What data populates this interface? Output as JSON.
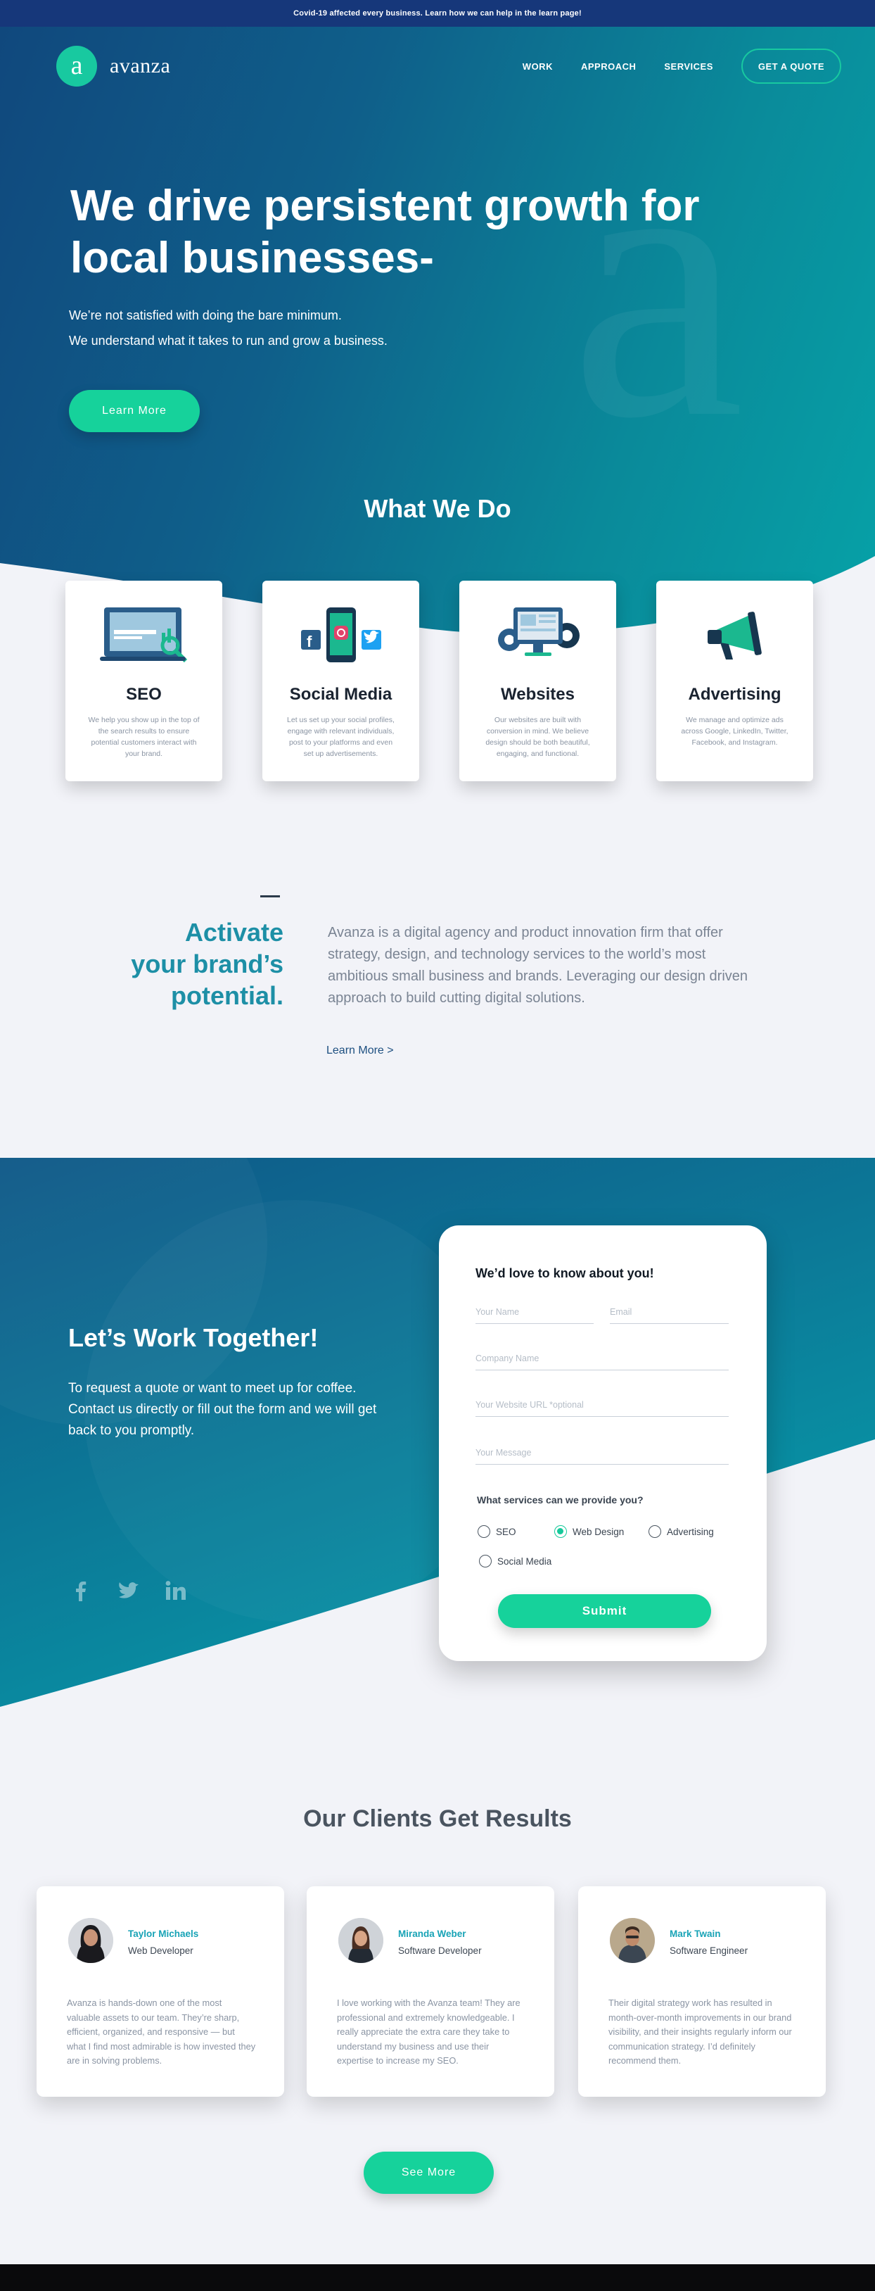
{
  "announcement": "Covid-19 affected every business. Learn how we can help in the learn page!",
  "brand": {
    "mark": "a",
    "name": "avanza"
  },
  "nav": {
    "items": [
      "WORK",
      "APPROACH",
      "SERVICES"
    ],
    "cta": "GET A QUOTE"
  },
  "hero": {
    "title_line1": "We drive persistent growth for",
    "title_line2": "local businesses-",
    "sub_line1": "We’re not satisfied with doing the bare minimum.",
    "sub_line2": "We understand what it takes to run and grow a business.",
    "button": "Learn More"
  },
  "services": {
    "heading": "What We Do",
    "cards": [
      {
        "icon": "seo-laptop-icon",
        "title": "SEO",
        "text": "We help you show up in the top of the search results to ensure potential customers interact with your brand."
      },
      {
        "icon": "social-phone-icon",
        "title": "Social Media",
        "text": "Let us set up your social profiles, engage with relevant individuals, post to your platforms and even set up advertisements."
      },
      {
        "icon": "website-monitor-icon",
        "title": "Websites",
        "text": "Our websites are built with conversion in mind. We believe design should be both beautiful, engaging, and functional."
      },
      {
        "icon": "megaphone-icon",
        "title": "Advertising",
        "text": "We manage and optimize ads across Google, LinkedIn, Twitter, Facebook, and Instagram."
      }
    ]
  },
  "about": {
    "title_line1": "Activate",
    "title_line2": "your brand’s",
    "title_line3": "potential.",
    "text": "Avanza is a digital agency and product innovation firm that offer strategy, design, and technology services to the world’s most ambitious small business and brands. Leveraging our design driven approach to build cutting digital solutions.",
    "link": "Learn More  >"
  },
  "contact": {
    "title": "Let’s Work Together!",
    "text": "To request a quote or want to meet up for coffee. Contact us directly or fill out the form and we will get back to you promptly.",
    "social": [
      "facebook-icon",
      "twitter-icon",
      "linkedin-icon"
    ],
    "form": {
      "title": "We’d love to know about you!",
      "name_placeholder": "Your Name",
      "email_placeholder": "Email",
      "company_placeholder": "Company Name",
      "website_placeholder": "Your Website URL *optional",
      "message_placeholder": "Your Message",
      "services_question": "What services can we provide you?",
      "options": [
        {
          "label": "SEO",
          "selected": false
        },
        {
          "label": "Web Design",
          "selected": true
        },
        {
          "label": "Advertising",
          "selected": false
        },
        {
          "label": "Social Media",
          "selected": false
        }
      ],
      "submit": "Submit"
    }
  },
  "testimonials": {
    "heading": "Our Clients Get Results",
    "items": [
      {
        "name": "Taylor Michaels",
        "role": "Web Developer",
        "quote": "Avanza is hands-down one of the most valuable assets to our team. They’re sharp, efficient, organized, and responsive — but what I find most admirable is how invested they are in solving problems."
      },
      {
        "name": "Miranda Weber",
        "role": "Software Developer",
        "quote": "I love working with the Avanza team! They are professional and extremely knowledgeable. I really appreciate the extra care they take to understand my business and use their expertise to increase my SEO."
      },
      {
        "name": "Mark Twain",
        "role": "Software Engineer",
        "quote": "Their digital strategy work has resulted in month-over-month improvements in our brand visibility, and their insights regularly inform our communication strategy. I’d definitely recommend them."
      }
    ],
    "button": "See More"
  },
  "colors": {
    "accent": "#16d29b",
    "teal": "#1d8fa6",
    "navy": "#16377a"
  }
}
